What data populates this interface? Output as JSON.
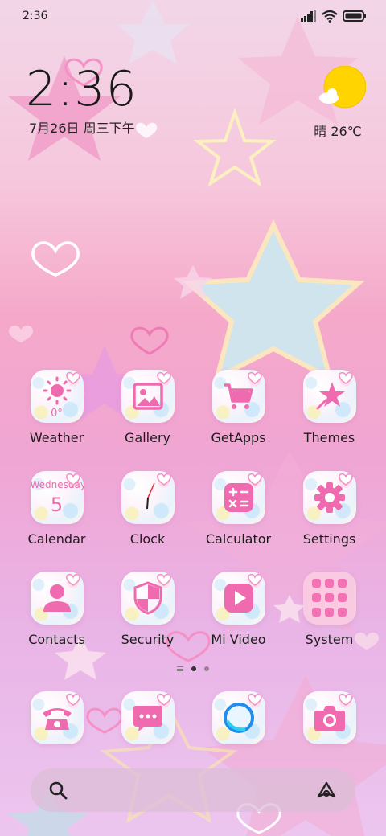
{
  "status_bar": {
    "time": "2:36"
  },
  "clock_widget": {
    "time": "2:36",
    "date": "7月26日 周三下午"
  },
  "weather_widget": {
    "temperature": "晴 26℃",
    "icon": "sun-cloud-icon"
  },
  "apps": [
    {
      "label": "Weather",
      "icon": "weather-sun-icon",
      "extra": "0°"
    },
    {
      "label": "Gallery",
      "icon": "gallery-image-icon"
    },
    {
      "label": "GetApps",
      "icon": "shopping-cart-icon"
    },
    {
      "label": "Themes",
      "icon": "themes-star-icon"
    },
    {
      "label": "Calendar",
      "icon": "calendar-icon",
      "extra_day": "Wednesday",
      "extra_date": "5"
    },
    {
      "label": "Clock",
      "icon": "clock-icon"
    },
    {
      "label": "Calculator",
      "icon": "calculator-icon"
    },
    {
      "label": "Settings",
      "icon": "gear-icon"
    },
    {
      "label": "Contacts",
      "icon": "contacts-person-icon"
    },
    {
      "label": "Security",
      "icon": "shield-icon"
    },
    {
      "label": "Mi Video",
      "icon": "play-video-icon"
    },
    {
      "label": "System",
      "icon": "folder-grid-icon"
    }
  ],
  "dock": [
    {
      "icon": "phone-icon"
    },
    {
      "icon": "messages-icon"
    },
    {
      "icon": "browser-icon"
    },
    {
      "icon": "camera-icon"
    }
  ],
  "search_bar": {
    "left_icon": "search-icon",
    "right_icon": "assistant-icon"
  },
  "colors": {
    "accent_pink": "#f06ab0",
    "sun_yellow": "#ffd400"
  }
}
